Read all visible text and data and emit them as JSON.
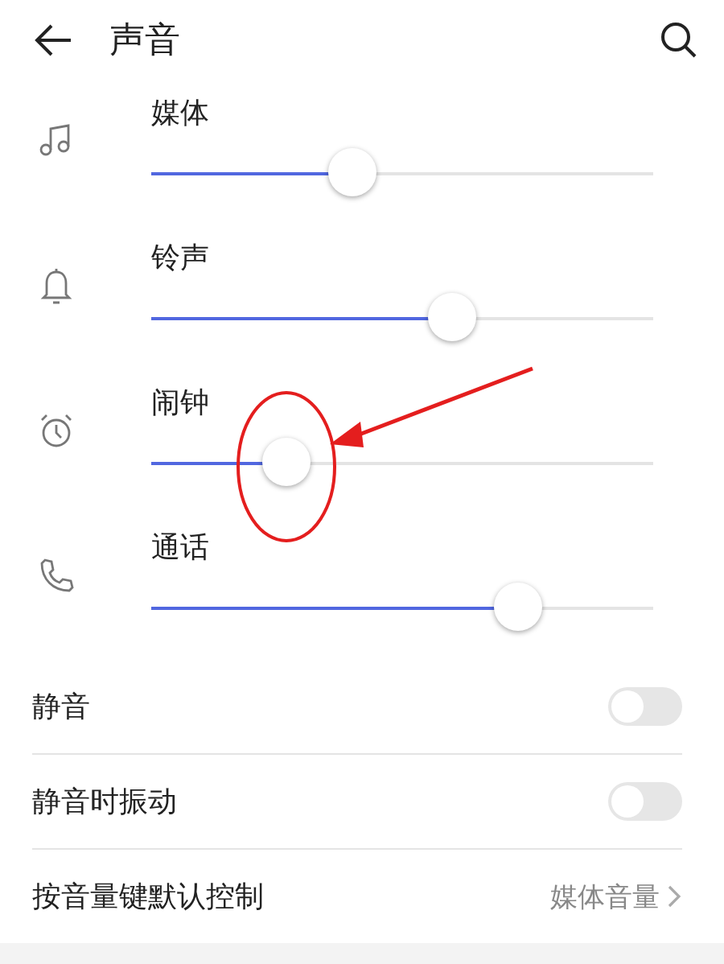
{
  "header": {
    "title": "声音"
  },
  "sliders": [
    {
      "kind": "music",
      "label": "媒体",
      "level": 0.4,
      "annotated": false
    },
    {
      "kind": "bell",
      "label": "铃声",
      "level": 0.6,
      "annotated": false
    },
    {
      "kind": "alarm",
      "label": "闹钟",
      "level": 0.27,
      "annotated": true
    },
    {
      "kind": "phone",
      "label": "通话",
      "level": 0.73,
      "annotated": false
    }
  ],
  "settings": [
    {
      "kind": "toggle",
      "label": "静音",
      "on": false
    },
    {
      "kind": "toggle",
      "label": "静音时振动",
      "on": false
    },
    {
      "kind": "link",
      "label": "按音量键默认控制",
      "value": "媒体音量"
    }
  ]
}
